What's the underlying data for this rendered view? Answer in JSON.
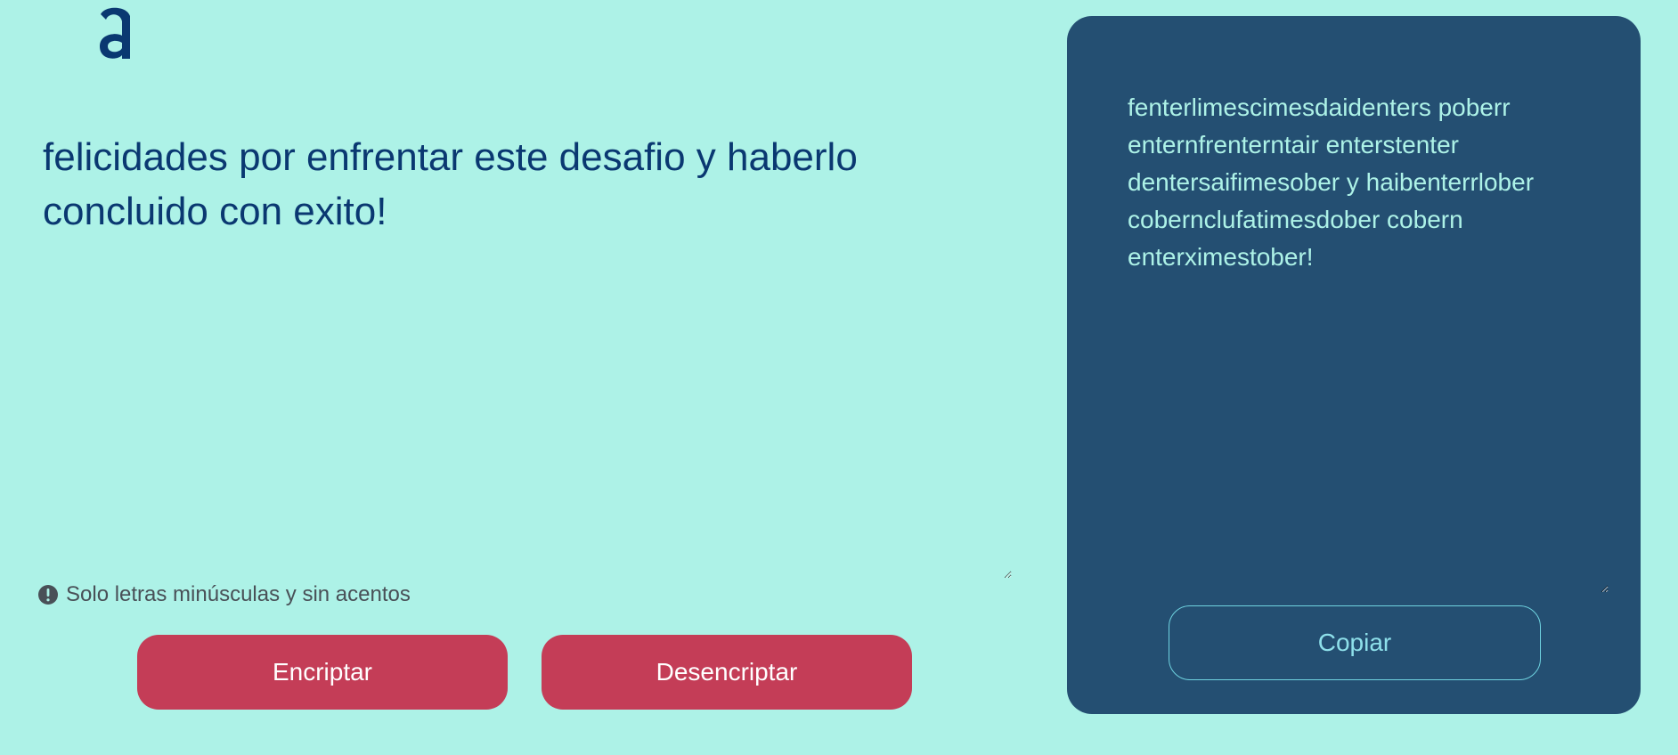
{
  "app": {
    "logo_icon": "alura-a-logo-icon",
    "colors": {
      "background": "#adf2e7",
      "primary_text": "#0a3871",
      "button": "#c43d57",
      "panel": "#244f72",
      "panel_text": "#adf2e7"
    }
  },
  "input": {
    "value": "felicidades por enfrentar este desafio y haberlo concluido con exito!"
  },
  "warning": {
    "icon": "exclamation-circle-icon",
    "text": "Solo letras minúsculas y sin acentos"
  },
  "buttons": {
    "encrypt_label": "Encriptar",
    "decrypt_label": "Desencriptar"
  },
  "output": {
    "value": "fenterlimescimesdaidenters poberr enternfrenterntair enterstenter dentersaifimesober y haibenterrlober cobernclufatimesdober cobern enterximestober!",
    "copy_label": "Copiar"
  }
}
